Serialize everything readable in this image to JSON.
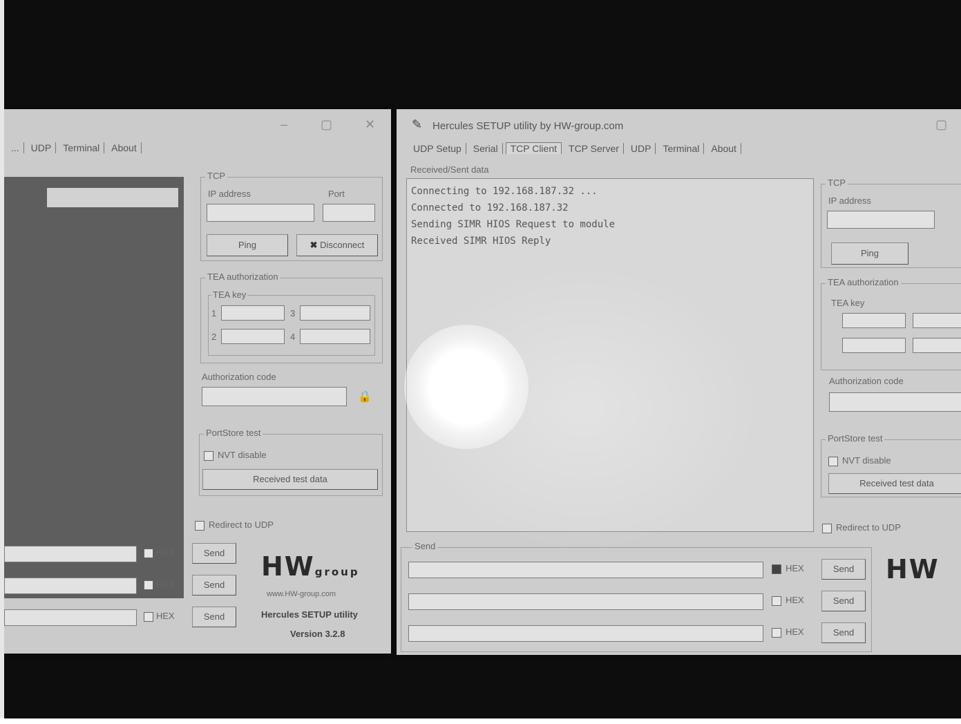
{
  "left_window": {
    "title": "",
    "tabs": [
      "...",
      "UDP",
      "Terminal",
      "About"
    ],
    "list_item": "",
    "tcp_group_label": "TCP",
    "ip_label": "IP address",
    "port_label": "Port",
    "ip_value": "",
    "port_value": "",
    "ping_button": "Ping",
    "disconnect_button": "Disconnect",
    "auth_group_label": "TEA authorization",
    "tea_key_label": "TEA key",
    "key1": "",
    "key2": "",
    "key3": "",
    "key4": "",
    "auth_code_label": "Authorization code",
    "portstore_label": "PortStore test",
    "nvt_label": "NVT disable",
    "received_button": "Received test data",
    "redirect_label": "Redirect to UDP",
    "send_rows": [
      {
        "hex_label": "HEX",
        "send_label": "Send"
      },
      {
        "hex_label": "HEX",
        "send_label": "Send"
      },
      {
        "hex_label": "HEX",
        "send_label": "Send"
      }
    ],
    "logo_main": "HW",
    "logo_sub": "group",
    "logo_url": "www.HW-group.com",
    "product_name": "Hercules SETUP utility",
    "version": "Version 3.2.8"
  },
  "right_window": {
    "title": "Hercules SETUP utility by HW-group.com",
    "tabs": [
      "UDP Setup",
      "Serial",
      "TCP Client",
      "TCP Server",
      "UDP",
      "Terminal",
      "About"
    ],
    "subtab": "Received/Sent data",
    "console_lines": [
      "Connecting to 192.168.187.32 ...",
      "Connected to 192.168.187.32",
      "Sending SIMR HIOS Request to module",
      "Received SIMR HIOS Reply",
      "",
      "",
      ""
    ],
    "tcp_group_label": "TCP",
    "ip_label": "IP address",
    "ip_value": "",
    "ping_button": "Ping",
    "auth_group_label": "TEA authorization",
    "tea_key_label": "TEA key",
    "auth_code_label": "Authorization code",
    "portstore_label": "PortStore test",
    "nvt_label": "NVT disable",
    "received_button": "Received test data",
    "redirect_label": "Redirect to UDP",
    "send_group_label": "Send",
    "send_rows": [
      {
        "value": "",
        "hex_label": "HEX",
        "send_label": "Send",
        "hex_checked": true
      },
      {
        "value": "",
        "hex_label": "HEX",
        "send_label": "Send",
        "hex_checked": false
      },
      {
        "value": "",
        "hex_label": "HEX",
        "send_label": "Send",
        "hex_checked": false
      }
    ],
    "logo_main": "HW",
    "logo_sub": "",
    "logo_url": "",
    "product_name": "",
    "version": ""
  },
  "colors": {
    "background": "#0d0d0d",
    "window": "#cbcbcb",
    "list_panel": "#5e5e5e"
  }
}
